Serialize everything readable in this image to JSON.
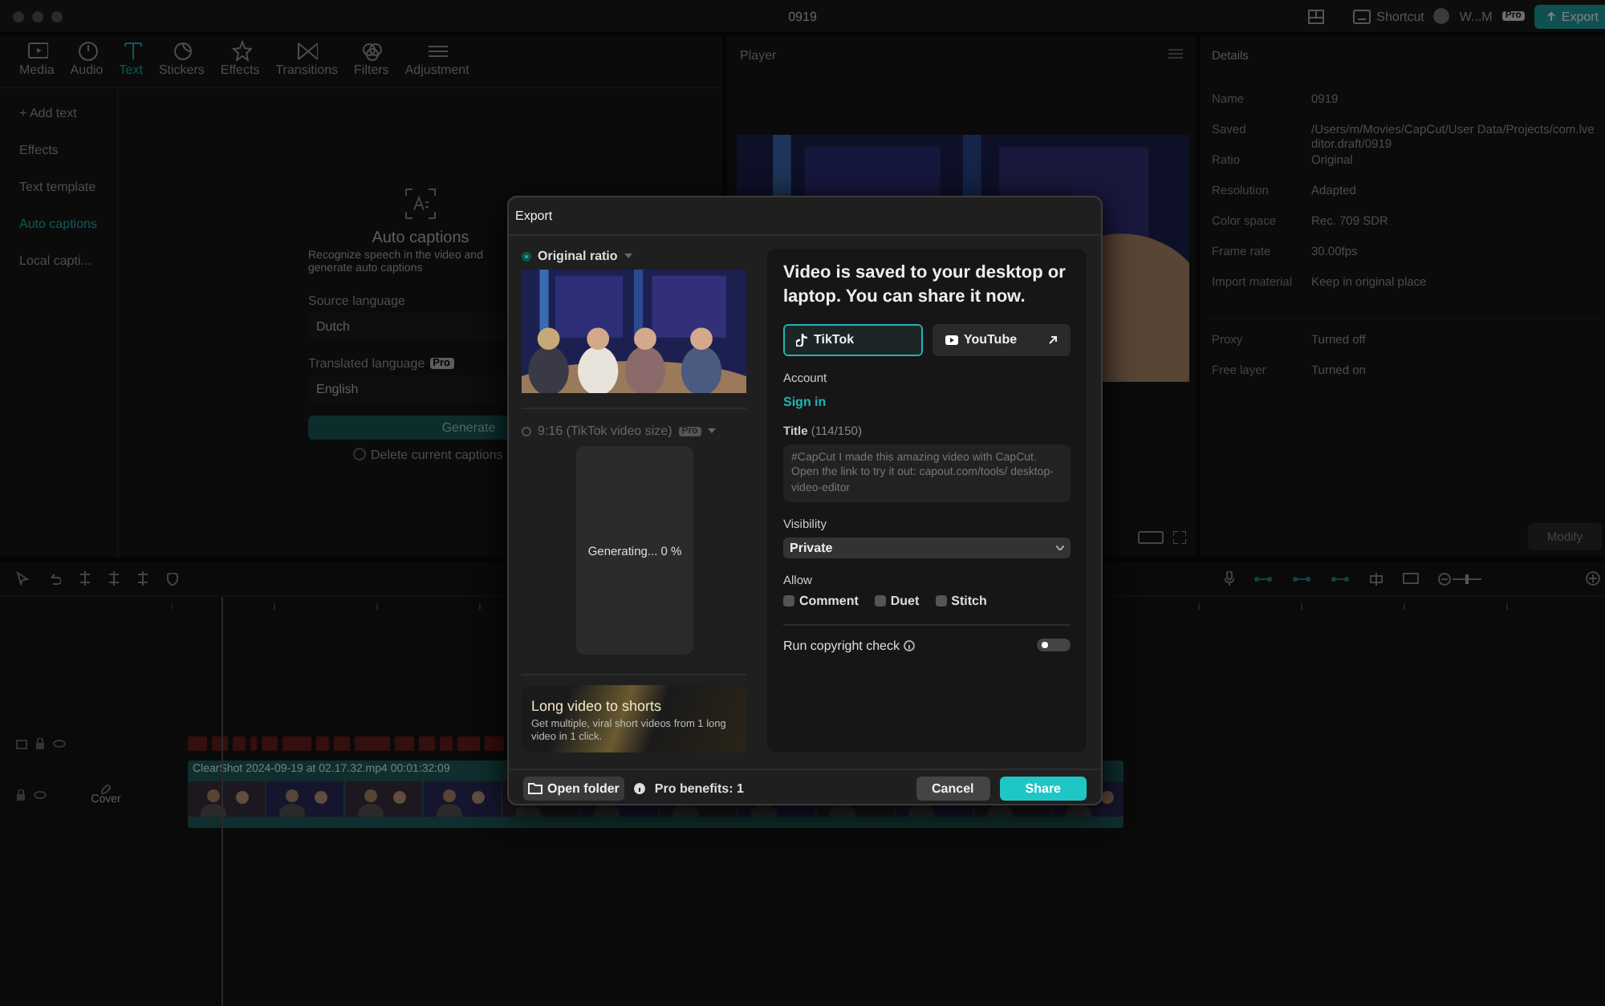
{
  "window": {
    "title": "0919"
  },
  "header": {
    "shortcut": "Shortcut",
    "user": "W...M",
    "user_badge": "Pro",
    "export_button": "Export"
  },
  "toolbar": [
    {
      "label": "Media",
      "selected": false
    },
    {
      "label": "Audio",
      "selected": false
    },
    {
      "label": "Text",
      "selected": true
    },
    {
      "label": "Stickers",
      "selected": false
    },
    {
      "label": "Effects",
      "selected": false
    },
    {
      "label": "Transitions",
      "selected": false
    },
    {
      "label": "Filters",
      "selected": false
    },
    {
      "label": "Adjustment",
      "selected": false
    }
  ],
  "sidebar": [
    {
      "label": "+ Add text",
      "selected": false
    },
    {
      "label": "Effects",
      "selected": false
    },
    {
      "label": "Text template",
      "selected": false
    },
    {
      "label": "Auto captions",
      "selected": true
    },
    {
      "label": "Local capti...",
      "selected": false
    }
  ],
  "auto_captions": {
    "title": "Auto captions",
    "description": "Recognize speech in the video and generate auto captions",
    "source_label": "Source language",
    "source_value": "Dutch",
    "translated_label": "Translated language",
    "translated_badge": "Pro",
    "translated_value": "English",
    "generate_button": "Generate",
    "delete_option": {
      "label": "Delete current captions",
      "checked": false
    }
  },
  "player": {
    "title": "Player"
  },
  "details": {
    "title": "Details",
    "rows": [
      {
        "label": "Name",
        "value": "0919"
      },
      {
        "label": "Saved",
        "value": "/Users/m/Movies/CapCut/User Data/Projects/com.lveditor.draft/0919"
      },
      {
        "label": "Ratio",
        "value": "Original"
      },
      {
        "label": "Resolution",
        "value": "Adapted"
      },
      {
        "label": "Color space",
        "value": "Rec. 709 SDR"
      },
      {
        "label": "Frame rate",
        "value": "30.00fps"
      },
      {
        "label": "Import material",
        "value": "Keep in original place"
      },
      {
        "label": "Proxy",
        "value": "Turned off"
      },
      {
        "label": "Free layer",
        "value": "Turned on"
      }
    ],
    "button": "Modify"
  },
  "timeline": {
    "clip_label": "ClearShot 2024-09-19 at 02.17.32.mp4  00:01:32:09",
    "cover_label": "Cover"
  },
  "export": {
    "title": "Export",
    "ratio_options": [
      {
        "label": "Original ratio",
        "selected": true,
        "kind": "preview"
      },
      {
        "label": "9:16 (TikTok video size)",
        "badge": "Pro",
        "selected": false,
        "kind": "generating",
        "status": "Generating... 0 %"
      }
    ],
    "promo": {
      "title": "Long video to shorts",
      "text": "Get multiple, viral short videos from 1 long video in 1 click."
    },
    "heading": "Video is saved to your desktop or laptop. You can share it now.",
    "platforms": [
      {
        "label": "TikTok",
        "selected": true,
        "external": false
      },
      {
        "label": "YouTube",
        "selected": false,
        "external": true
      }
    ],
    "account_label": "Account",
    "sign_in": "Sign in",
    "title_label": "Title",
    "title_count": "(114/150)",
    "title_value": "#CapCut I made this amazing video with CapCut. Open the link to try it out: capout.com/tools/ desktop-video-editor",
    "visibility_label": "Visibility",
    "visibility_value": "Private",
    "allow_label": "Allow",
    "allow": [
      {
        "label": "Comment",
        "checked": false
      },
      {
        "label": "Duet",
        "checked": false
      },
      {
        "label": "Stitch",
        "checked": false
      }
    ],
    "copyright_check": {
      "label": "Run copyright check",
      "on": false
    },
    "open_folder": "Open folder",
    "pro_benefits": "Pro benefits: 1",
    "cancel": "Cancel",
    "share": "Share"
  }
}
